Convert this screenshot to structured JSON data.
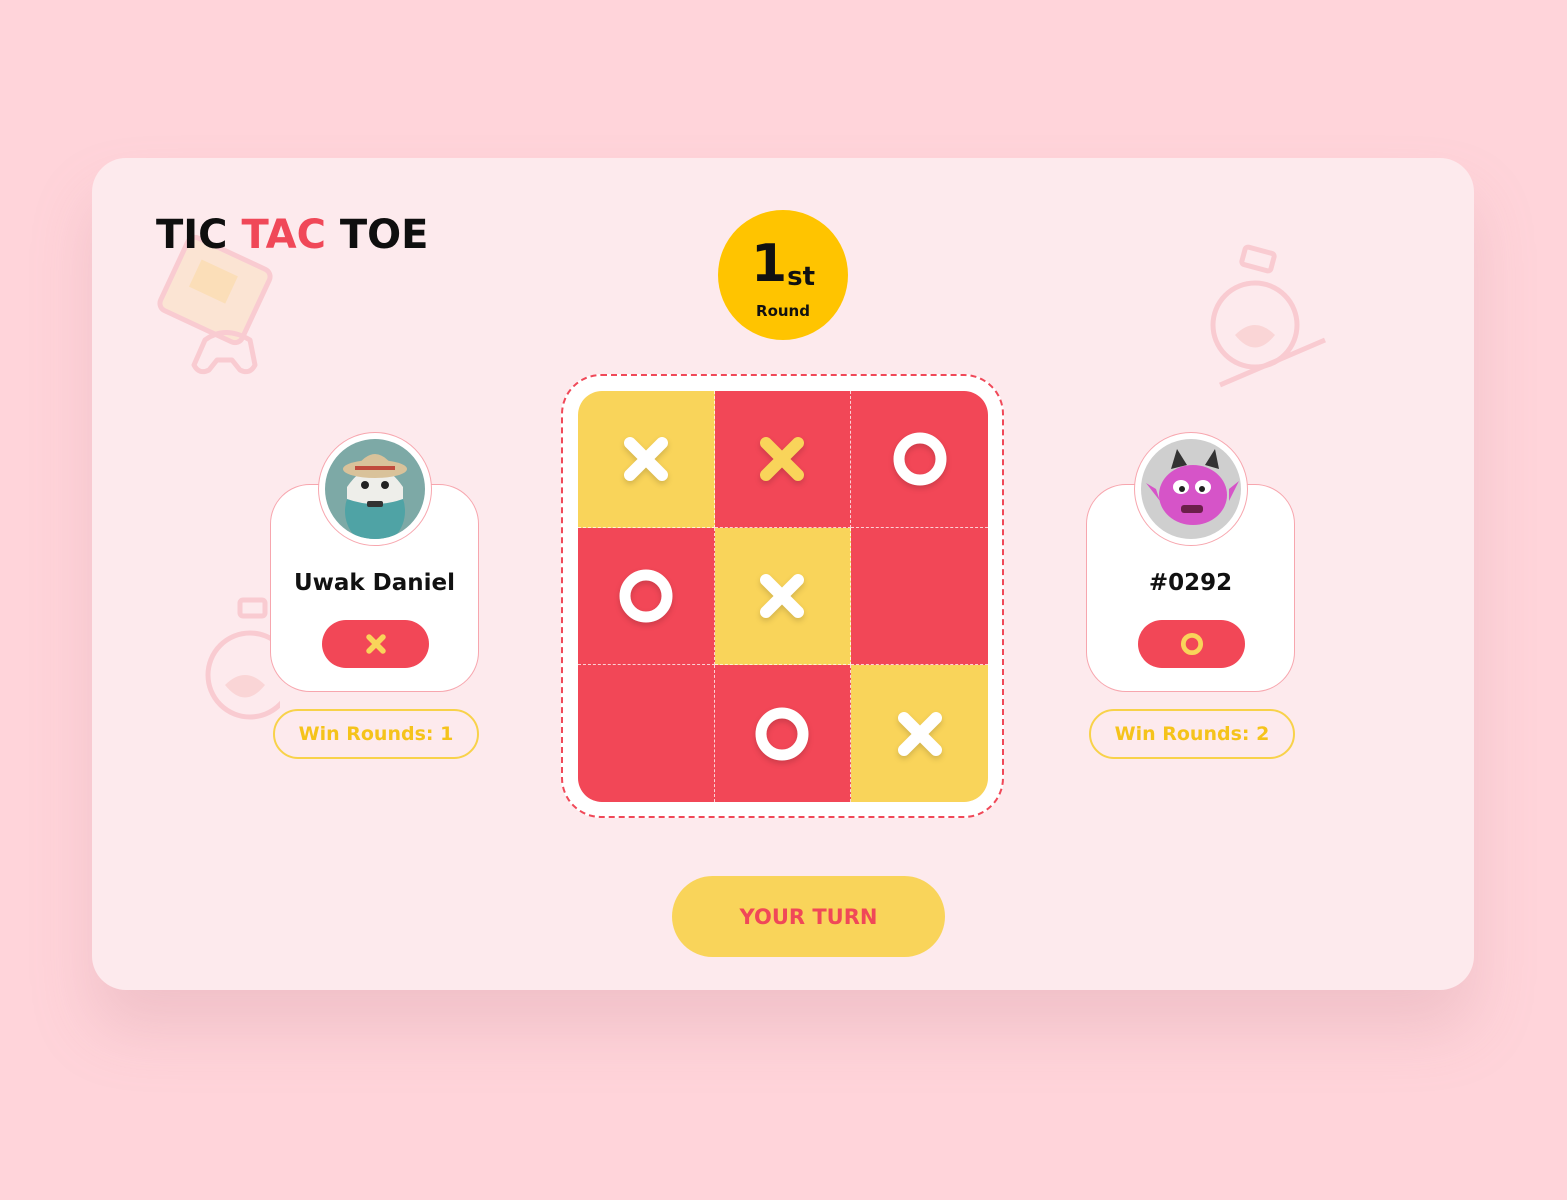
{
  "title": {
    "part1": "TIC ",
    "part2": "TAC",
    "part3": " TOE"
  },
  "round": {
    "number": "1",
    "suffix": "st",
    "label": "Round"
  },
  "board": {
    "cells": [
      {
        "mark": "x",
        "mark_color": "white",
        "bg": "yellow"
      },
      {
        "mark": "x",
        "mark_color": "yellow",
        "bg": "red"
      },
      {
        "mark": "o",
        "mark_color": "white",
        "bg": "red"
      },
      {
        "mark": "o",
        "mark_color": "white",
        "bg": "red"
      },
      {
        "mark": "x",
        "mark_color": "white",
        "bg": "yellow"
      },
      {
        "mark": "",
        "mark_color": "",
        "bg": "red"
      },
      {
        "mark": "",
        "mark_color": "",
        "bg": "red"
      },
      {
        "mark": "o",
        "mark_color": "white",
        "bg": "red"
      },
      {
        "mark": "x",
        "mark_color": "white",
        "bg": "yellow"
      }
    ]
  },
  "players": [
    {
      "name": "Uwak Daniel",
      "symbol": "x",
      "win_rounds": "Win Rounds: 1",
      "avatar": "teal-robot-avatar"
    },
    {
      "name": "#0292",
      "symbol": "o",
      "win_rounds": "Win Rounds: 2",
      "avatar": "pink-monster-avatar"
    }
  ],
  "action": {
    "label": "YOUR TURN"
  },
  "colors": {
    "background": "#ffd4da",
    "card": "#fdeaed",
    "red": "#f24757",
    "yellow": "#f9d45a",
    "gold": "#ffc400",
    "accent_text": "#f04858"
  }
}
